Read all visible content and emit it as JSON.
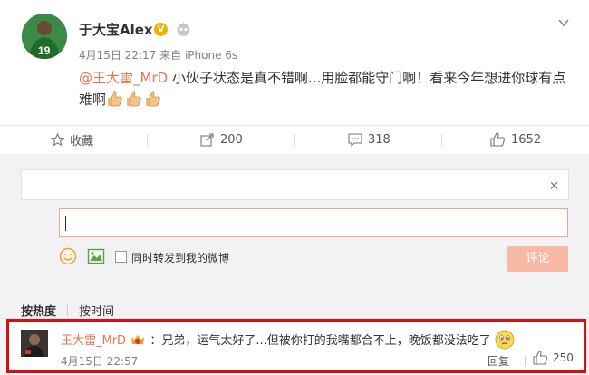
{
  "post": {
    "author": "于大宝Alex",
    "badge": "V",
    "date": "4月15日 22:17",
    "source": "来自 iPhone 6s",
    "mention": "@王大雷_MrD",
    "body": " 小伙子状态是真不错啊...用脸都能守门啊！看来今年想进你球有点难啊"
  },
  "actions": {
    "favorite_label": "收藏",
    "repost_count": "200",
    "comment_count": "318",
    "like_count": "1652"
  },
  "comment_box": {
    "forward_close": "×",
    "checkbox_label": "同时转发到我的微博",
    "submit_label": "评论"
  },
  "sort": {
    "hot": "按热度",
    "time": "按时间"
  },
  "comment": {
    "author": "王大雷_MrD",
    "text": "：兄弟，运气太好了...但被你打的我嘴都合不上，晚饭都没法吃了",
    "time": "4月15日 22:57",
    "reply_label": "回复",
    "like_count": "250"
  },
  "colors": {
    "accent": "#eb7350",
    "highlight_border": "#d51013",
    "panel_bg": "#f2f2f5"
  }
}
